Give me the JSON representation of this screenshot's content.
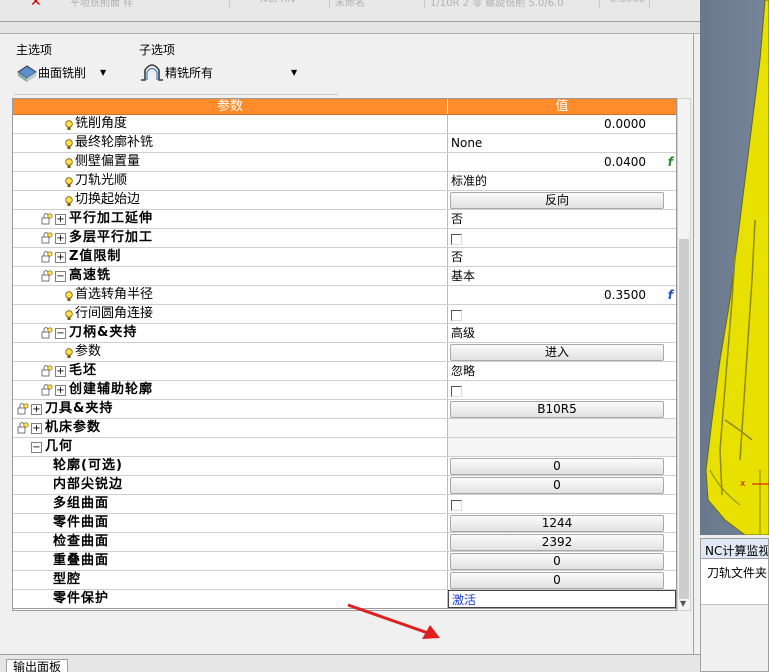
{
  "top": {
    "cell1": "平坦铣削面 样",
    "cell2": "NCPRN",
    "cell3": "未命名",
    "cell4": "1/10R 2 零 螺旋铣削 5.0/6.0",
    "cell5": "0.0000"
  },
  "panel": {
    "main_label": "主选项",
    "sub_label": "子选项",
    "main_value": "曲面铣削",
    "sub_value": "精铣所有",
    "toolbar_icons": [
      "key-icon",
      "screen-icon",
      "import-icon",
      "search-icon",
      "save-icon",
      "filter-icon",
      "tools-icon",
      "lock-icon"
    ]
  },
  "grid": {
    "col_param": "参数",
    "col_value": "值",
    "rows": [
      {
        "name": "铣削角度",
        "indent": 3,
        "icon": "bulb",
        "value": "0.0000",
        "vtype": "num"
      },
      {
        "name": "最终轮廓补铣",
        "indent": 3,
        "icon": "bulb",
        "value": "None",
        "vtype": "text"
      },
      {
        "name": "侧壁偏置量",
        "indent": 3,
        "icon": "bulb",
        "value": "0.0400",
        "vtype": "numf",
        "fx": "f"
      },
      {
        "name": "刀轨光顺",
        "indent": 3,
        "icon": "bulb",
        "value": "标准的",
        "vtype": "text"
      },
      {
        "name": "切换起始边",
        "indent": 3,
        "icon": "bulb",
        "value": "反向",
        "vtype": "button"
      },
      {
        "name": "平行加工延伸",
        "indent": 2,
        "icon": "lockexp",
        "exp": "+",
        "value": "否",
        "vtype": "text",
        "bold": true
      },
      {
        "name": "多层平行加工",
        "indent": 2,
        "icon": "lockexp",
        "exp": "+",
        "value": "",
        "vtype": "check",
        "bold": true
      },
      {
        "name": "Z值限制",
        "indent": 2,
        "icon": "lockexp",
        "exp": "+",
        "value": "否",
        "vtype": "text",
        "bold": true
      },
      {
        "name": "高速铣",
        "indent": 2,
        "icon": "lockexp",
        "exp": "−",
        "value": "基本",
        "vtype": "text",
        "bold": true
      },
      {
        "name": "首选转角半径",
        "indent": 3,
        "icon": "bulb",
        "value": "0.3500",
        "vtype": "numf",
        "fx": "f"
      },
      {
        "name": "行间圆角连接",
        "indent": 3,
        "icon": "bulb",
        "value": "",
        "vtype": "check"
      },
      {
        "name": "刀柄&夹持",
        "indent": 2,
        "icon": "lockexp",
        "exp": "−",
        "value": "高级",
        "vtype": "text",
        "bold": true
      },
      {
        "name": "参数",
        "indent": 3,
        "icon": "bulb",
        "value": "进入",
        "vtype": "button"
      },
      {
        "name": "毛坯",
        "indent": 2,
        "icon": "lockexp",
        "exp": "+",
        "value": "忽略",
        "vtype": "text",
        "bold": true
      },
      {
        "name": "创建辅助轮廓",
        "indent": 2,
        "icon": "lockexp",
        "exp": "+",
        "value": "",
        "vtype": "check",
        "bold": true
      },
      {
        "name": "刀具&夹持",
        "indent": 1,
        "icon": "lockexp",
        "exp": "+",
        "value": "B10R5",
        "vtype": "button",
        "bold": true
      },
      {
        "name": "机床参数",
        "indent": 1,
        "icon": "lockexp",
        "exp": "+",
        "value": "",
        "vtype": "empty",
        "bold": true
      },
      {
        "name": "几何",
        "indent": 1,
        "icon": "exp",
        "exp": "−",
        "value": "",
        "vtype": "empty",
        "bold": true
      },
      {
        "name": "轮廓(可选)",
        "indent": 4,
        "icon": "none",
        "value": "0",
        "vtype": "button",
        "bold": true
      },
      {
        "name": "内部尖锐边",
        "indent": 4,
        "icon": "none",
        "value": "0",
        "vtype": "button",
        "bold": true
      },
      {
        "name": "多组曲面",
        "indent": 4,
        "icon": "none",
        "value": "",
        "vtype": "check",
        "bold": true
      },
      {
        "name": "零件曲面",
        "indent": 4,
        "icon": "none",
        "value": "1244",
        "vtype": "button",
        "bold": true
      },
      {
        "name": "检查曲面",
        "indent": 4,
        "icon": "none",
        "value": "2392",
        "vtype": "button",
        "bold": true
      },
      {
        "name": "重叠曲面",
        "indent": 4,
        "icon": "none",
        "value": "0",
        "vtype": "button",
        "bold": true
      },
      {
        "name": "型腔",
        "indent": 4,
        "icon": "none",
        "value": "0",
        "vtype": "button",
        "bold": true
      },
      {
        "name": "零件保护",
        "indent": 4,
        "icon": "none",
        "value": "激活",
        "vtype": "activate",
        "bold": true
      }
    ]
  },
  "nc": {
    "title": "NC计算监视",
    "sub": "刀轨文件夹"
  },
  "bottom": {
    "tab": "输出面板"
  },
  "colors": {
    "header": "#ff8c2a",
    "part_yellow": "#e8e000"
  }
}
